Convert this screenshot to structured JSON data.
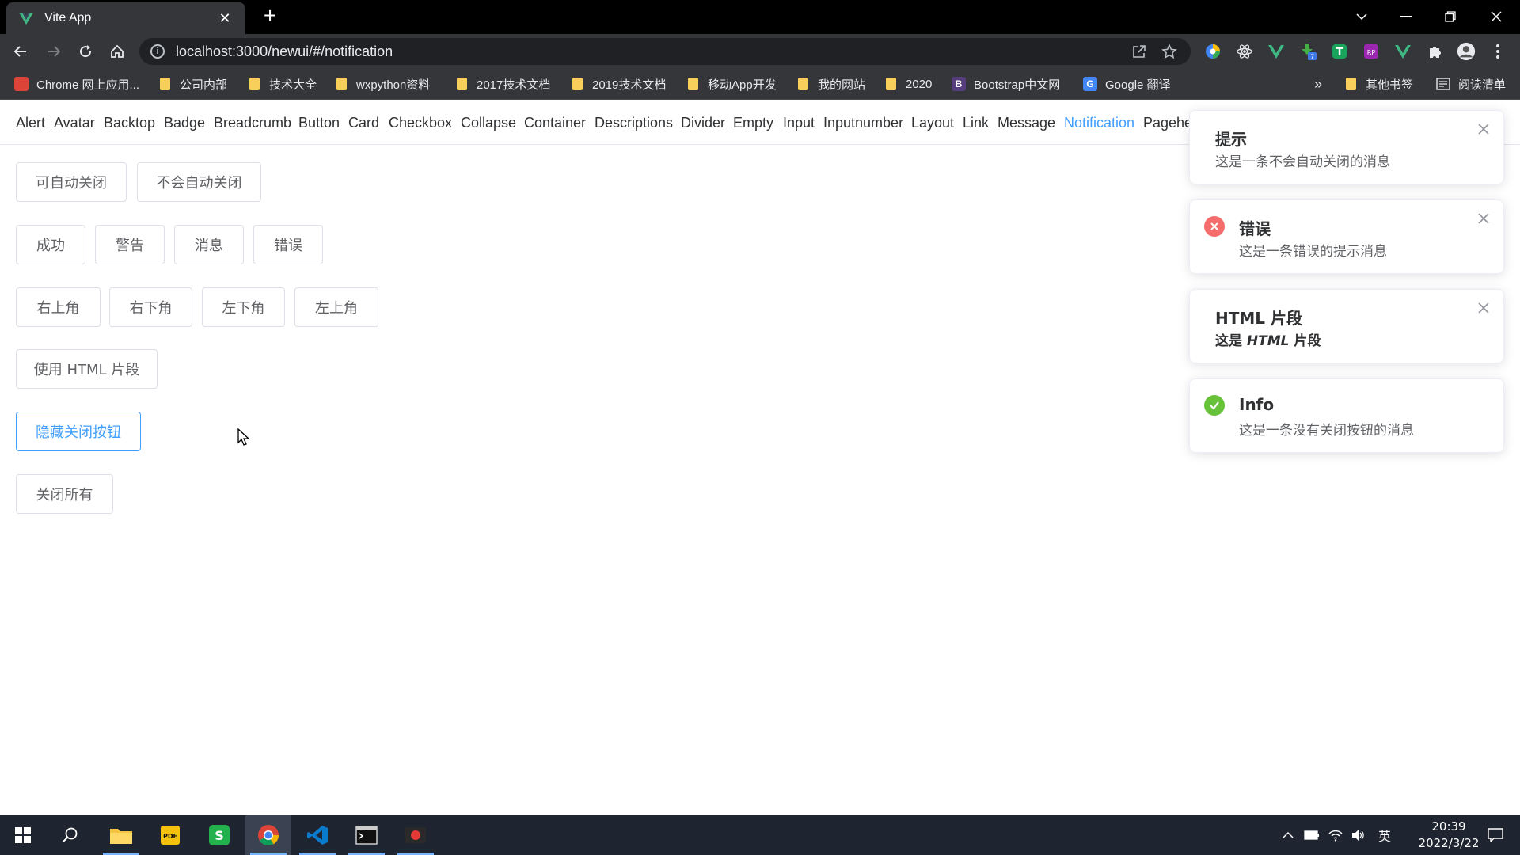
{
  "browser": {
    "tab_title": "Vite App",
    "tab_close": "✕",
    "new_tab": "+",
    "url": "localhost:3000/newui/#/notification",
    "bookmarks": [
      {
        "label": "Chrome 网上应用..."
      },
      {
        "label": "公司内部"
      },
      {
        "label": "技术大全"
      },
      {
        "label": "wxpython资料"
      },
      {
        "label": "2017技术文档"
      },
      {
        "label": "2019技术文档"
      },
      {
        "label": "移动App开发"
      },
      {
        "label": "我的网站"
      },
      {
        "label": "2020"
      },
      {
        "label": "Bootstrap中文网"
      },
      {
        "label": "Google 翻译"
      }
    ],
    "bookmarks_overflow": "»",
    "other_bookmarks": "其他书签",
    "reading_list": "阅读清单"
  },
  "component_nav": {
    "items": [
      "Alert",
      "Avatar",
      "Backtop",
      "Badge",
      "Breadcrumb",
      "Button",
      "Card",
      "Checkbox",
      "Collapse",
      "Container",
      "Descriptions",
      "Divider",
      "Empty",
      "Input",
      "Inputnumber",
      "Layout",
      "Link",
      "Message",
      "Notification",
      "Pagehe"
    ],
    "active": "Notification"
  },
  "demo_buttons": {
    "auto_close": "可自动关闭",
    "no_auto_close": "不会自动关闭",
    "success": "成功",
    "warning": "警告",
    "info": "消息",
    "error": "错误",
    "top_right": "右上角",
    "bottom_right": "右下角",
    "bottom_left": "左下角",
    "top_left": "左上角",
    "use_html": "使用 HTML 片段",
    "hide_close": "隐藏关闭按钮",
    "close_all": "关闭所有"
  },
  "notifications": [
    {
      "title": "提示",
      "message": "这是一条不会自动关闭的消息",
      "icon": "none"
    },
    {
      "title": "错误",
      "message": "这是一条错误的提示消息",
      "icon": "error-icon"
    },
    {
      "title": "HTML 片段",
      "message_prefix": "这是",
      "message_em": "HTML",
      "message_suffix": "片段",
      "icon": "none"
    },
    {
      "title": "Info",
      "message": "这是一条没有关闭按钮的消息",
      "icon": "success-icon"
    }
  ],
  "taskbar": {
    "ime": "英",
    "time": "20:39",
    "date": "2022/3/22"
  },
  "colors": {
    "primary": "#409eff",
    "error": "#f56c6c",
    "success": "#67c23a",
    "chrome_dark": "#35363a"
  }
}
